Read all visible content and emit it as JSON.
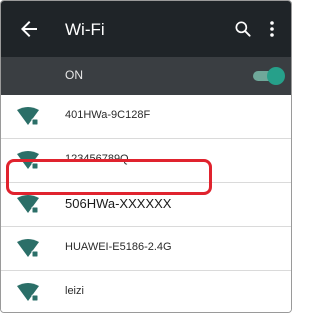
{
  "header": {
    "title": "Wi-Fi",
    "back_icon": "arrow-left-icon",
    "search_icon": "search-icon",
    "more_icon": "more-vert-icon"
  },
  "switch": {
    "label": "ON",
    "state": "on",
    "accent": "#26a08a"
  },
  "networks": [
    {
      "name": "401HWa-9C128F",
      "icon": "wifi-secured-icon"
    },
    {
      "name": "123456789Q",
      "icon": "wifi-secured-icon"
    },
    {
      "name": "506HWa-XXXXXX",
      "icon": "wifi-secured-icon",
      "selected": true
    },
    {
      "name": "HUAWEI-E5186-2.4G",
      "icon": "wifi-secured-icon"
    },
    {
      "name": "leizi",
      "icon": "wifi-secured-icon"
    }
  ],
  "colors": {
    "appbar": "#1f2428",
    "switchbar": "#3a3e42",
    "wifi_icon": "#2b6f68",
    "highlight": "#e0232e"
  }
}
